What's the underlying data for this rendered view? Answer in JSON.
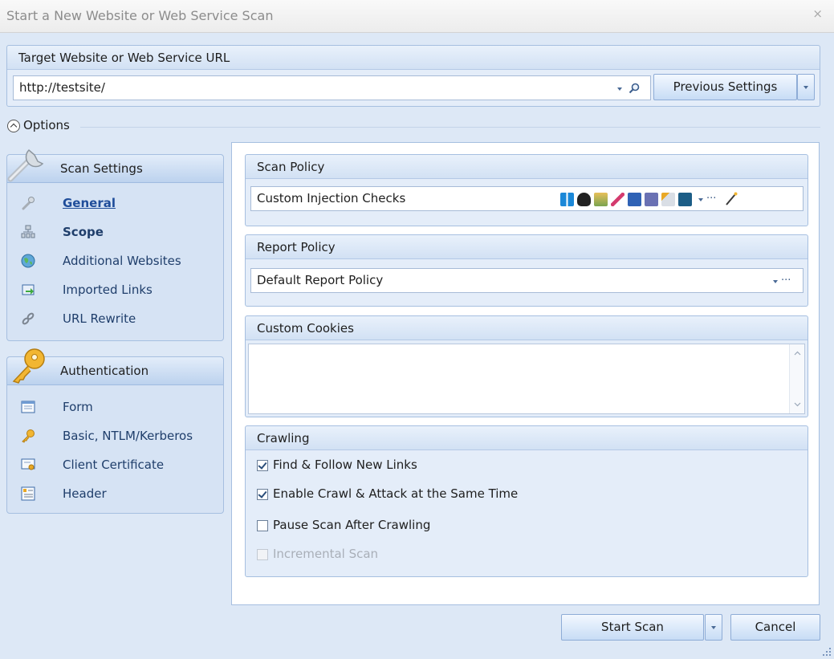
{
  "window": {
    "title": "Start a New Website or Web Service Scan",
    "close_glyph": "×"
  },
  "target": {
    "header": "Target Website or Web Service URL",
    "url_value": "http://testsite/",
    "previous_settings_label": "Previous Settings"
  },
  "options": {
    "label": "Options"
  },
  "sidebar": {
    "scan_settings": {
      "header": "Scan Settings",
      "items": [
        {
          "label": "General",
          "icon": "wrench-icon",
          "selected": true
        },
        {
          "label": "Scope",
          "icon": "scope-tree-icon",
          "bold": true
        },
        {
          "label": "Additional Websites",
          "icon": "globe-icon"
        },
        {
          "label": "Imported Links",
          "icon": "import-links-icon"
        },
        {
          "label": "URL Rewrite",
          "icon": "chain-link-icon"
        }
      ]
    },
    "authentication": {
      "header": "Authentication",
      "items": [
        {
          "label": "Form",
          "icon": "form-icon"
        },
        {
          "label": "Basic, NTLM/Kerberos",
          "icon": "key-icon"
        },
        {
          "label": "Client Certificate",
          "icon": "certificate-icon"
        },
        {
          "label": "Header",
          "icon": "header-icon"
        }
      ]
    }
  },
  "scan_policy": {
    "header": "Scan Policy",
    "value": "Custom Injection Checks",
    "ellipsis": "···"
  },
  "report_policy": {
    "header": "Report Policy",
    "value": "Default Report Policy",
    "ellipsis": "···"
  },
  "custom_cookies": {
    "header": "Custom Cookies",
    "value": ""
  },
  "crawling": {
    "header": "Crawling",
    "options": [
      {
        "label": "Find & Follow New Links",
        "checked": true,
        "enabled": true
      },
      {
        "label": "Enable Crawl & Attack at the Same Time",
        "checked": true,
        "enabled": true
      },
      {
        "label": "Pause Scan After Crawling",
        "checked": false,
        "enabled": true
      },
      {
        "label": "Incremental Scan",
        "checked": false,
        "enabled": false
      }
    ]
  },
  "footer": {
    "start_scan_label": "Start Scan",
    "cancel_label": "Cancel"
  },
  "colors": {
    "accent": "#1f4d9a",
    "panel": "#dde8f6",
    "border": "#a6bfe0"
  }
}
